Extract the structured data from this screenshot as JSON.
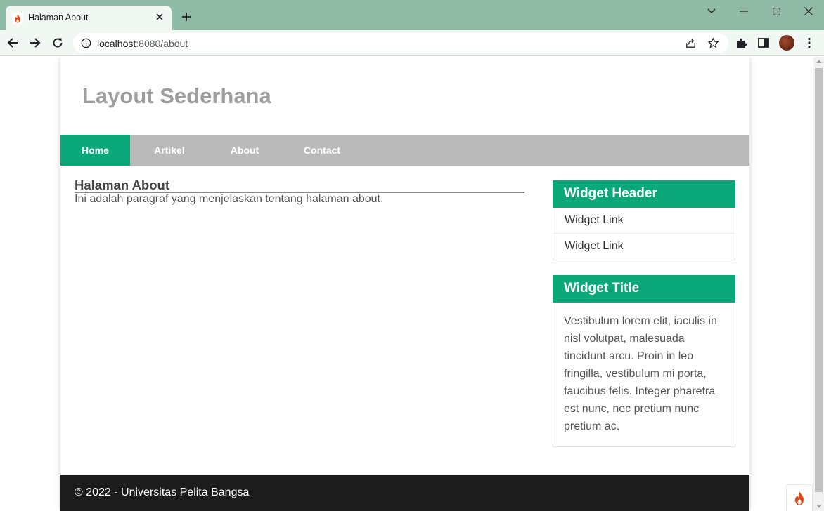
{
  "browser": {
    "tab_title": "Halaman About",
    "url_host": "localhost",
    "url_port_path": ":8080/about"
  },
  "site": {
    "title": "Layout Sederhana",
    "nav": [
      {
        "label": "Home",
        "active": true
      },
      {
        "label": "Artikel",
        "active": false
      },
      {
        "label": "About",
        "active": false
      },
      {
        "label": "Contact",
        "active": false
      }
    ]
  },
  "content": {
    "heading": "Halaman About",
    "paragraph": "Ini adalah paragraf yang menjelaskan tentang halaman about."
  },
  "sidebar": {
    "widget1": {
      "header": "Widget Header",
      "links": [
        "Widget Link",
        "Widget Link"
      ]
    },
    "widget2": {
      "header": "Widget Title",
      "text": "Vestibulum lorem elit, iaculis in nisl volutpat, malesuada tincidunt arcu. Proin in leo fringilla, vestibulum mi porta, faucibus felis. Integer pharetra est nunc, nec pretium nunc pretium ac."
    }
  },
  "footer": {
    "text": "© 2022 - Universitas Pelita Bangsa"
  },
  "colors": {
    "accent": "#0aa879",
    "nav_bg": "#bababa",
    "footer_bg": "#1c1c1c",
    "title_gray": "#9e9e9e"
  },
  "icons": {
    "tab_favicon": "flame-icon",
    "tab_close": "close-icon",
    "new_tab": "plus-icon",
    "back": "arrow-left-icon",
    "forward": "arrow-right-icon",
    "reload": "reload-icon",
    "site_info": "info-icon",
    "share": "share-icon",
    "bookmark": "star-icon",
    "extensions": "puzzle-icon",
    "side_panel": "side-panel-icon",
    "menu": "kebab-menu-icon",
    "debug_toolbar": "codeigniter-flame-icon"
  }
}
